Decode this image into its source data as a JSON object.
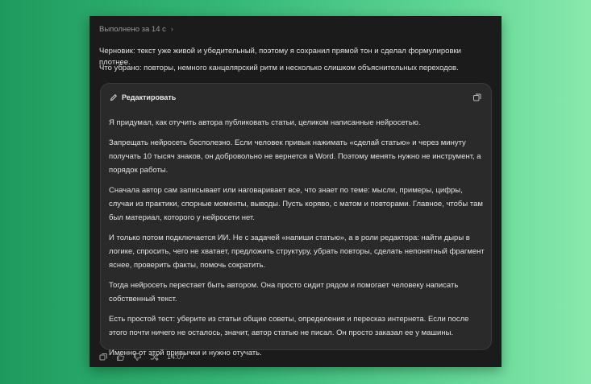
{
  "header": {
    "status": "Выполнено за 14 с"
  },
  "intro": {
    "line1": "Черновик: текст уже живой и убедительный, поэтому я сохранил прямой тон и сделал формулировки плотнее.",
    "line2": "Что убрано: повторы, немного канцелярский ритм и несколько слишком объяснительных переходов."
  },
  "card": {
    "edit_label": "Редактировать",
    "paragraphs": [
      "Я придумал, как отучить автора публиковать статьи, целиком написанные нейросетью.",
      "Запрещать нейросеть бесполезно. Если человек привык нажимать «сделай статью» и через минуту получать 10 тысяч знаков, он добровольно не вернется в Word. Поэтому менять нужно не инструмент, а порядок работы.",
      "Сначала автор сам записывает или наговаривает все, что знает по теме: мысли, примеры, цифры, случаи из практики, спорные моменты, выводы. Пусть коряво, с матом и повторами. Главное, чтобы там был материал, которого у нейросети нет.",
      "И только потом подключается ИИ. Не с задачей «напиши статью», а в роли редактора: найти дыры в логике, спросить, чего не хватает, предложить структуру, убрать повторы, сделать непонятный фрагмент яснее, проверить факты, помочь сократить.",
      "Тогда нейросеть перестает быть автором. Она просто сидит рядом и помогает человеку написать собственный текст.",
      "Есть простой тест: уберите из статьи общие советы, определения и пересказ интернета. Если после этого почти ничего не осталось, значит, автор статью не писал. Он просто заказал ее у машины.",
      "Именно от этой привычки и нужно отучать."
    ]
  },
  "footer": {
    "time": "14:07"
  },
  "icons": {
    "chevron": "chevron-right-icon",
    "edit": "pencil-icon",
    "copy": "copy-icon",
    "like": "thumbs-up-icon",
    "dislike": "thumbs-down-icon",
    "share": "share-icon"
  }
}
